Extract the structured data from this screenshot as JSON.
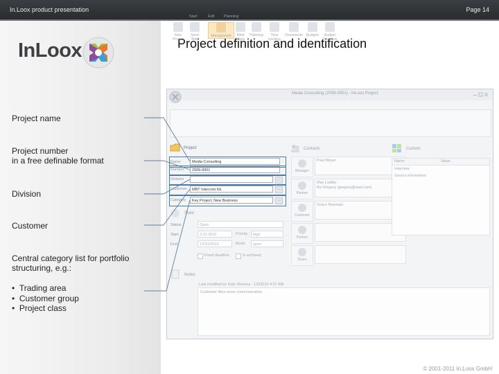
{
  "header": {
    "left": "In.Loox product presentation",
    "right": "Page 14"
  },
  "logo": {
    "text": "InLoox"
  },
  "slide_title": "Project definition and identification",
  "labels": [
    {
      "lines": [
        "Project name"
      ]
    },
    {
      "lines": [
        "Project number",
        "in a free definable format"
      ]
    },
    {
      "lines": [
        "Division"
      ]
    },
    {
      "lines": [
        "Customer"
      ]
    },
    {
      "lines": [
        "Central category list for portfolio",
        "structuring, e.g.:"
      ]
    }
  ],
  "bullets": [
    "Trading area",
    "Customer group",
    "Project class"
  ],
  "footer": "© 2001-2011 In.Loox GmbH",
  "app": {
    "window_title": "Media Consulting (2009-0001) - InLoox Project",
    "tabs": [
      "Start",
      "Edit",
      "Planning"
    ],
    "ribbon": [
      {
        "l1": "New",
        "l2": "Project"
      },
      {
        "l1": "Send",
        "l2": "Mail"
      },
      {
        "l1": "Management",
        "l2": ""
      },
      {
        "l1": "Mind",
        "l2": "Maps"
      },
      {
        "l1": "Planning",
        "l2": ""
      },
      {
        "l1": "Time",
        "l2": "tracking"
      },
      {
        "l1": "Documents",
        "l2": ""
      },
      {
        "l1": "Budgets",
        "l2": ""
      },
      {
        "l1": "Budget",
        "l2": "Overview"
      }
    ],
    "sections": {
      "project": "Project",
      "contacts": "Contacts",
      "custom": "Custom",
      "status": "State",
      "notes": "Notes"
    },
    "fields": {
      "name": {
        "label": "Name",
        "value": "Media Consulting"
      },
      "number": {
        "label": "Number",
        "value": "2009-0001"
      },
      "division": {
        "label": "Division",
        "value": ""
      },
      "customer": {
        "label": "Customer",
        "value": "MBT Intercom ltd."
      },
      "category": {
        "label": "Category",
        "value": "Key Project, New Business"
      }
    },
    "status_fields": {
      "state": {
        "label": "Status",
        "value": "Open"
      },
      "start": {
        "label": "Start",
        "value": "3.31.2010"
      },
      "end": {
        "label": "End",
        "value": "12/31/2010"
      },
      "priority": {
        "label": "Priority",
        "value": "high"
      },
      "mode": {
        "label": "Mode",
        "value": "open"
      },
      "fixed_deadline": "Fixed deadline",
      "archived": "Is archived"
    },
    "contacts": [
      {
        "role": "Manager",
        "text": [
          "Paul Meyer"
        ]
      },
      {
        "role": "Partner",
        "text": [
          "Max Lüdtke",
          "Bo Gregory (gregory@mail.com)"
        ]
      },
      {
        "role": "Customer",
        "text": [
          "Grace Newman"
        ]
      },
      {
        "role": "Partner",
        "text": [
          ""
        ]
      },
      {
        "role": "Share",
        "text": [
          ""
        ]
      }
    ],
    "custom_table": {
      "columns": [
        "Name",
        "Value"
      ],
      "rows": [
        "Interview",
        "Source information"
      ]
    },
    "notes": {
      "modified": "Last modified by Kate Stevens  -  1/5/2010 4:27 AM",
      "text": "Customer likes more communication."
    }
  }
}
